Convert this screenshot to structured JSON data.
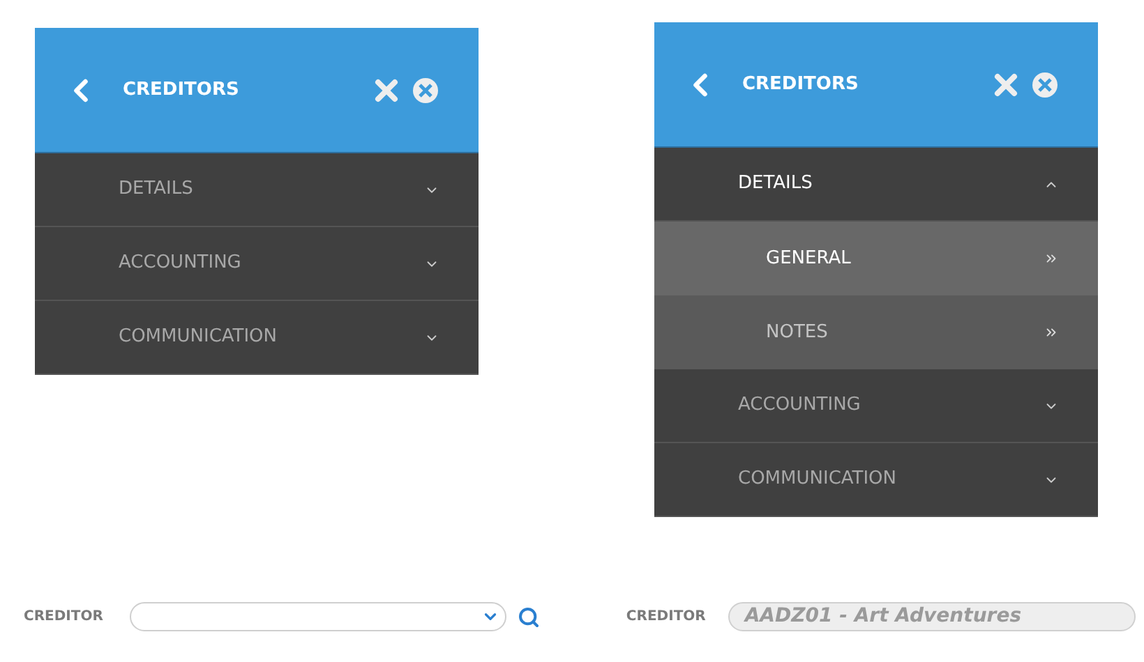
{
  "panels": [
    {
      "title": "CREDITORS",
      "items": [
        {
          "label": "DETAILS",
          "expanded": false
        },
        {
          "label": "ACCOUNTING",
          "expanded": false
        },
        {
          "label": "COMMUNICATION",
          "expanded": false
        }
      ]
    },
    {
      "title": "CREDITORS",
      "items": [
        {
          "label": "DETAILS",
          "expanded": true,
          "children": [
            {
              "label": "GENERAL",
              "selected": true
            },
            {
              "label": "NOTES",
              "selected": false
            }
          ]
        },
        {
          "label": "ACCOUNTING",
          "expanded": false
        },
        {
          "label": "COMMUNICATION",
          "expanded": false
        }
      ]
    }
  ],
  "fields": [
    {
      "label": "CREDITOR",
      "kind": "select"
    },
    {
      "label": "CREDITOR",
      "kind": "readonly",
      "value": "AADZ01 - Art Adventures"
    }
  ]
}
